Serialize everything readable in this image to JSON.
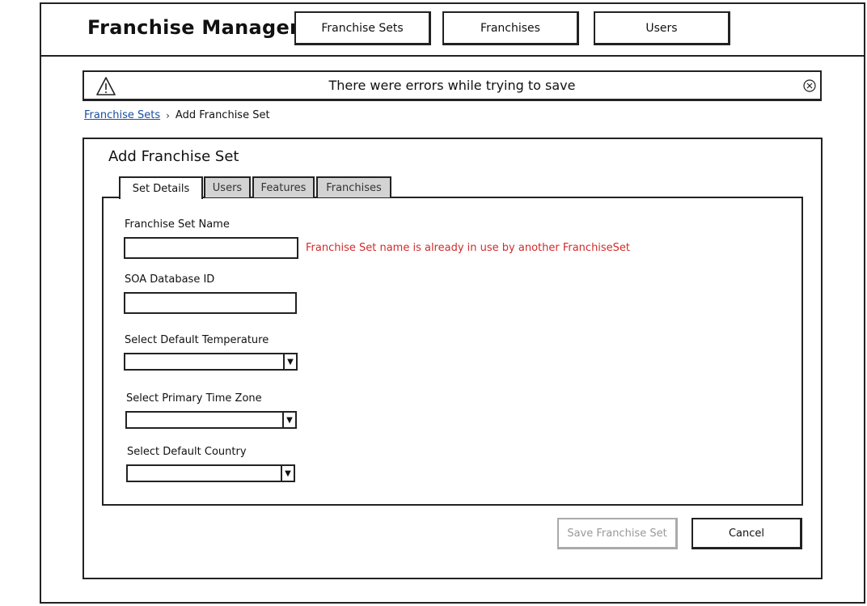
{
  "app": {
    "title": "Franchise Manager"
  },
  "nav": {
    "items": [
      {
        "label": "Franchise Sets"
      },
      {
        "label": "Franchises"
      },
      {
        "label": "Users"
      }
    ]
  },
  "alert": {
    "message": "There were errors while trying to save",
    "icon": "warning-icon",
    "close_icon": "close-icon"
  },
  "breadcrumb": {
    "parent": "Franchise Sets",
    "current": "Add Franchise Set"
  },
  "panel": {
    "title": "Add Franchise Set",
    "tabs": [
      {
        "label": "Set Details",
        "active": true
      },
      {
        "label": "Users",
        "active": false
      },
      {
        "label": "Features",
        "active": false
      },
      {
        "label": "Franchises",
        "active": false
      }
    ]
  },
  "form": {
    "name_label": "Franchise Set Name",
    "name_value": "",
    "name_error": "Franchise Set name is already in use by another FranchiseSet",
    "soa_label": "SOA Database ID",
    "soa_value": "",
    "temperature_label": "Select Default Temperature",
    "temperature_value": "",
    "timezone_label": "Select Primary Time Zone",
    "timezone_value": "",
    "country_label": "Select Default Country",
    "country_value": ""
  },
  "actions": {
    "save_label": "Save Franchise Set",
    "save_disabled": true,
    "cancel_label": "Cancel"
  },
  "colors": {
    "link": "#1a4fa0",
    "error": "#d12b2b",
    "inactive_tab": "#d3d3d3",
    "disabled_text": "#999999"
  }
}
